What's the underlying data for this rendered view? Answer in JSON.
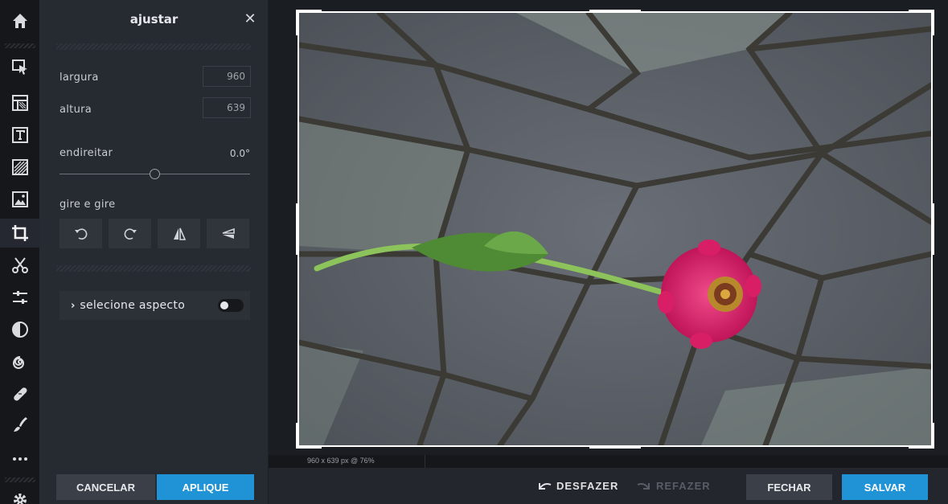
{
  "rail": {
    "icons": [
      "home-icon",
      "select-icon",
      "layout-icon",
      "text-icon",
      "overlay-icon",
      "sticker-icon",
      "crop-icon",
      "cutout-icon",
      "adjust-icon",
      "contrast-icon",
      "swirl-icon",
      "bandage-icon",
      "brush-icon",
      "more-icon",
      "settings-icon"
    ]
  },
  "panel": {
    "title": "ajustar",
    "close_glyph": "✕",
    "width_label": "largura",
    "width_value": "960",
    "height_label": "altura",
    "height_value": "639",
    "straighten_label": "endireitar",
    "straighten_value": "0.0°",
    "straighten_level": 0.0,
    "rotate_label": "gire e gire",
    "aspect_chevron": "›",
    "aspect_label": "selecione aspecto",
    "aspect_toggle_on": false,
    "cancel_label": "CANCELAR",
    "apply_label": "APLIQUE"
  },
  "status": {
    "info": "960 x 639 px @ 76%"
  },
  "bottom": {
    "undo_label": "DESFAZER",
    "redo_label": "REFAZER",
    "close_label": "FECHAR",
    "save_label": "SALVAR"
  },
  "colors": {
    "accent": "#1f93d6",
    "panel_bg": "#262a31",
    "rail_bg": "#15171b",
    "flower": "#d8226a"
  }
}
